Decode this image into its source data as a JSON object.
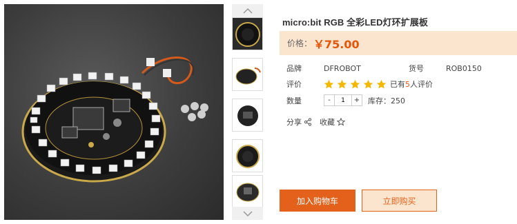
{
  "product": {
    "title": "micro:bit RGB 全彩LED灯环扩展板",
    "price_label": "价格：",
    "price": "￥75.00"
  },
  "specs": {
    "brand_label": "品牌",
    "brand": "DFROBOT",
    "sku_label": "货号",
    "sku": "ROB0150",
    "rating_label": "评价",
    "rating_stars": 5,
    "review_prefix": "已有",
    "review_count": "5",
    "review_suffix": "人评价",
    "qty_label": "数量",
    "qty_minus": "-",
    "qty_value": "1",
    "qty_plus": "+",
    "stock_text": "库存：250",
    "share_label": "分享",
    "fav_label": "收藏"
  },
  "actions": {
    "add_to_cart": "加入购物车",
    "buy_now": "立即购买"
  },
  "colors": {
    "accent": "#e4611b",
    "price": "#e5550a",
    "price_bg": "#fbe5cf",
    "star": "#f5b800"
  },
  "icons": {
    "share": "share-icon",
    "favorite": "star-outline-icon",
    "thumb_up": "chevron-up-icon",
    "thumb_down": "chevron-down-icon"
  }
}
